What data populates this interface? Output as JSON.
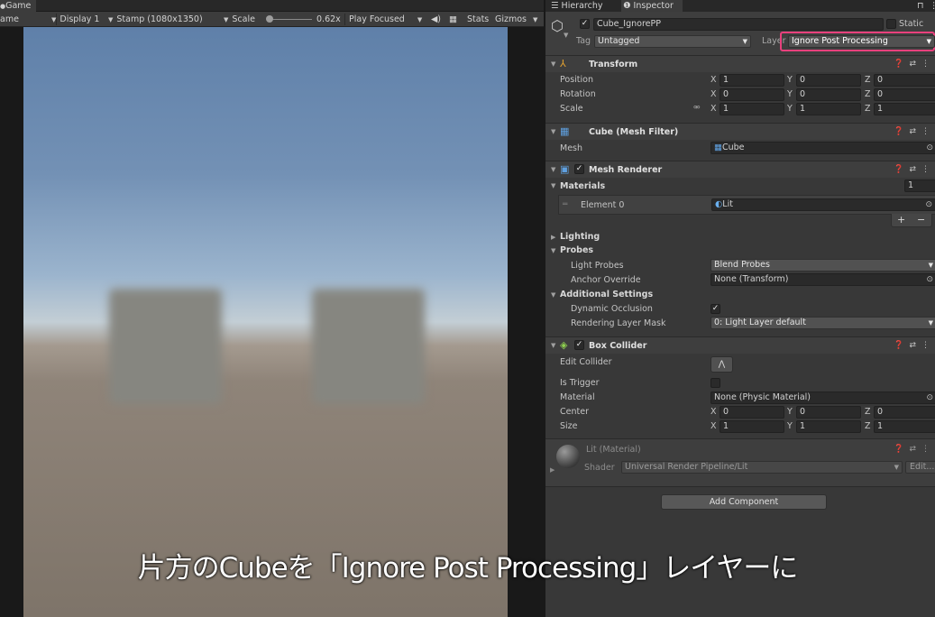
{
  "game": {
    "tab_label": "Game",
    "toolbar": {
      "mode": "ame",
      "display": "Display 1",
      "resolution": "Stamp (1080x1350)",
      "scale_label": "Scale",
      "scale_value": "0.62x",
      "play_mode": "Play Focused",
      "stats": "Stats",
      "gizmos": "Gizmos"
    }
  },
  "subtitle": "片方のCubeを「Ignore Post Processing」レイヤーに",
  "inspector": {
    "tabs": {
      "hierarchy": "Hierarchy",
      "inspector": "Inspector"
    },
    "object": {
      "name": "Cube_IgnorePP",
      "static_label": "Static",
      "tag_label": "Tag",
      "tag_value": "Untagged",
      "layer_label": "Layer",
      "layer_value": "Ignore Post Processing",
      "highlight_color": "#e8417d"
    },
    "transform": {
      "title": "Transform",
      "position": {
        "label": "Position",
        "x": "1",
        "y": "0",
        "z": "0"
      },
      "rotation": {
        "label": "Rotation",
        "x": "0",
        "y": "0",
        "z": "0"
      },
      "scale": {
        "label": "Scale",
        "x": "1",
        "y": "1",
        "z": "1"
      }
    },
    "axes": {
      "x": "X",
      "y": "Y",
      "z": "Z"
    },
    "mesh_filter": {
      "title": "Cube (Mesh Filter)",
      "mesh_label": "Mesh",
      "mesh_value": "Cube"
    },
    "mesh_renderer": {
      "title": "Mesh Renderer",
      "materials_label": "Materials",
      "materials_count": "1",
      "element_label": "Element 0",
      "element_value": "Lit",
      "add": "+",
      "remove": "−",
      "lighting": "Lighting",
      "probes": "Probes",
      "light_probes_label": "Light Probes",
      "light_probes_value": "Blend Probes",
      "anchor_label": "Anchor Override",
      "anchor_value": "None (Transform)",
      "additional": "Additional Settings",
      "dynamic_occlusion": "Dynamic Occlusion",
      "rendering_layer_label": "Rendering Layer Mask",
      "rendering_layer_value": "0: Light Layer default"
    },
    "box_collider": {
      "title": "Box Collider",
      "edit_label": "Edit Collider",
      "is_trigger": "Is Trigger",
      "material_label": "Material",
      "material_value": "None (Physic Material)",
      "center": {
        "label": "Center",
        "x": "0",
        "y": "0",
        "z": "0"
      },
      "size": {
        "label": "Size",
        "x": "1",
        "y": "1",
        "z": "1"
      }
    },
    "material": {
      "title": "Lit (Material)",
      "shader_label": "Shader",
      "shader_value": "Universal Render Pipeline/Lit",
      "edit": "Edit..."
    },
    "add_component": "Add Component"
  }
}
